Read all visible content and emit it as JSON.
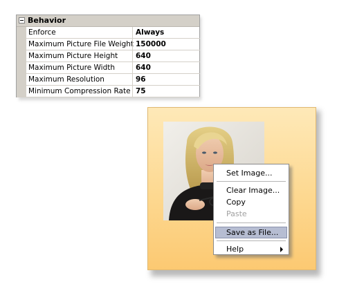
{
  "property_grid": {
    "category": "Behavior",
    "rows": [
      {
        "name": "Enforce",
        "value": "Always"
      },
      {
        "name": "Maximum Picture File Weight",
        "value": "150000"
      },
      {
        "name": "Maximum Picture Height",
        "value": "640"
      },
      {
        "name": "Maximum Picture Width",
        "value": "640"
      },
      {
        "name": "Maximum Resolution",
        "value": "96"
      },
      {
        "name": "Minimum Compression Rate",
        "value": "75"
      }
    ]
  },
  "context_menu": {
    "items": {
      "set_image": "Set Image...",
      "clear_image": "Clear Image...",
      "copy": "Copy",
      "paste": "Paste",
      "save_as_file": "Save as File...",
      "help": "Help"
    }
  },
  "colors": {
    "panel_gradient_top": "#fee9b8",
    "panel_gradient_bottom": "#fcc972",
    "menu_highlight": "#b6bdd2"
  }
}
